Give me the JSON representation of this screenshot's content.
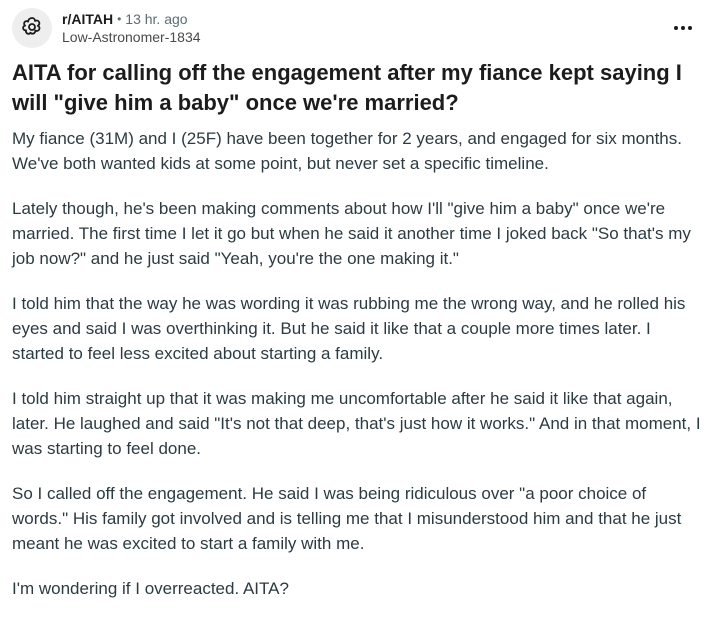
{
  "post": {
    "subreddit": "r/AITAH",
    "separator": "•",
    "time_ago": "13 hr. ago",
    "author": "Low-Astronomer-1834",
    "more_icon": "ellipsis-icon",
    "title": "AITA for calling off the engagement after my fiance kept saying I will \"give him a baby\" once we're married?",
    "paragraphs": [
      "My fiance (31M) and I (25F) have been together for 2 years, and engaged for six months. We've both wanted kids at some point, but never set a specific timeline.",
      "Lately though, he's been making comments about how I'll \"give him a baby\" once we're married. The first time I let it go but when he said it another time I joked back \"So that's my job now?\" and he just said \"Yeah, you're the one making it.\"",
      "I told him that the way he was wording it was rubbing me the wrong way, and he rolled his eyes and said I was overthinking it. But he said it like that a couple more times later. I started to feel less excited about starting a family.",
      "I told him straight up that it was making me uncomfortable after he said it like that again, later. He laughed and said \"It's not that deep, that's just how it works.\" And in that moment, I was starting to feel done.",
      "So I called off the engagement. He said I was being ridiculous over \"a poor choice of words.\" His family got involved and is telling me that I misunderstood him and that he just meant he was excited to start a family with me.",
      "I'm wondering if I overreacted. AITA?"
    ]
  },
  "colors": {
    "text": "#1c1c1c",
    "body_text": "#2a3c42",
    "meta_text": "#576f76",
    "avatar_bg": "#eeeeee"
  }
}
